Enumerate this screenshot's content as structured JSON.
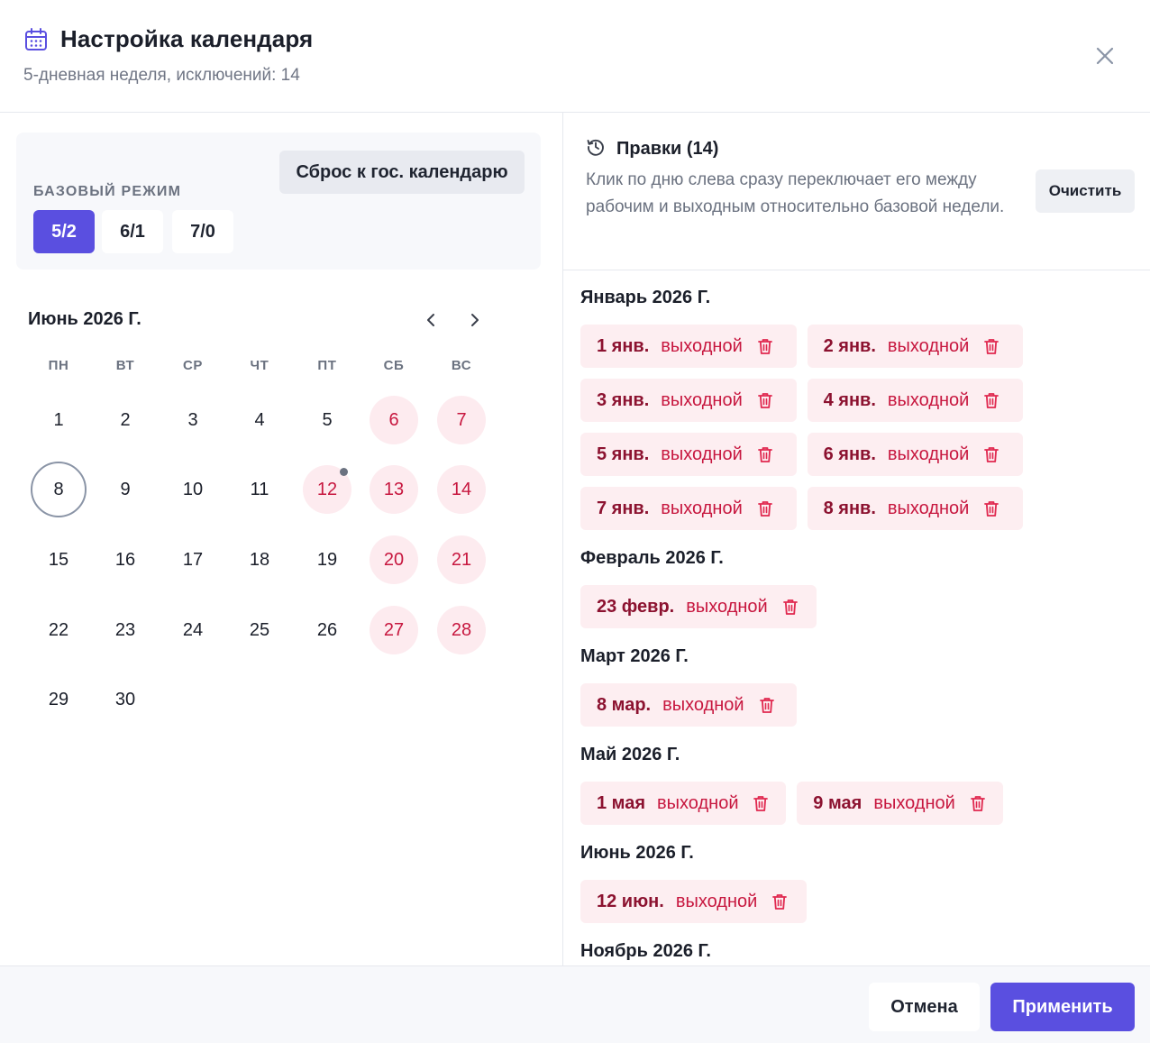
{
  "header": {
    "title": "Настройка календаря",
    "subtitle": "5-дневная неделя, исключений: 14",
    "icon": "calendar-icon",
    "accent": "#5a4fe0"
  },
  "base_mode": {
    "label": "БАЗОВЫЙ РЕЖИМ",
    "reset_label": "Сброс к гос. календарю",
    "modes": [
      "5/2",
      "6/1",
      "7/0"
    ],
    "selected": "5/2"
  },
  "calendar": {
    "month_title": "Июнь 2026 Г.",
    "weekdays": [
      "ПН",
      "ВТ",
      "СР",
      "ЧТ",
      "ПТ",
      "СБ",
      "ВС"
    ],
    "today": 8,
    "weeks": [
      [
        {
          "d": "1"
        },
        {
          "d": "2"
        },
        {
          "d": "3"
        },
        {
          "d": "4"
        },
        {
          "d": "5"
        },
        {
          "d": "6",
          "off": true
        },
        {
          "d": "7",
          "off": true
        }
      ],
      [
        {
          "d": "8",
          "today": true
        },
        {
          "d": "9"
        },
        {
          "d": "10"
        },
        {
          "d": "11"
        },
        {
          "d": "12",
          "off": true,
          "edited": true
        },
        {
          "d": "13",
          "off": true
        },
        {
          "d": "14",
          "off": true
        }
      ],
      [
        {
          "d": "15"
        },
        {
          "d": "16"
        },
        {
          "d": "17"
        },
        {
          "d": "18"
        },
        {
          "d": "19"
        },
        {
          "d": "20",
          "off": true
        },
        {
          "d": "21",
          "off": true
        }
      ],
      [
        {
          "d": "22"
        },
        {
          "d": "23"
        },
        {
          "d": "24"
        },
        {
          "d": "25"
        },
        {
          "d": "26"
        },
        {
          "d": "27",
          "off": true
        },
        {
          "d": "28",
          "off": true
        }
      ],
      [
        {
          "d": "29"
        },
        {
          "d": "30"
        }
      ]
    ],
    "weekend_color": "#c7173f"
  },
  "edits": {
    "title": "Правки (14)",
    "description": "Клик по дню слева сразу переключает его между рабочим и выходным относительно базовой недели.",
    "clear_label": "Очистить",
    "groups": [
      {
        "title": "Январь 2026 Г.",
        "items": [
          {
            "date": "1 янв.",
            "kind": "выходной"
          },
          {
            "date": "2 янв.",
            "kind": "выходной"
          },
          {
            "date": "3 янв.",
            "kind": "выходной"
          },
          {
            "date": "4 янв.",
            "kind": "выходной"
          },
          {
            "date": "5 янв.",
            "kind": "выходной"
          },
          {
            "date": "6 янв.",
            "kind": "выходной"
          },
          {
            "date": "7 янв.",
            "kind": "выходной"
          },
          {
            "date": "8 янв.",
            "kind": "выходной"
          }
        ]
      },
      {
        "title": "Февраль 2026 Г.",
        "items": [
          {
            "date": "23 февр.",
            "kind": "выходной"
          }
        ]
      },
      {
        "title": "Март 2026 Г.",
        "items": [
          {
            "date": "8 мар.",
            "kind": "выходной"
          }
        ]
      },
      {
        "title": "Май 2026 Г.",
        "items": [
          {
            "date": "1 мая",
            "kind": "выходной"
          },
          {
            "date": "9 мая",
            "kind": "выходной"
          }
        ]
      },
      {
        "title": "Июнь 2026 Г.",
        "items": [
          {
            "date": "12 июн.",
            "kind": "выходной"
          }
        ]
      },
      {
        "title": "Ноябрь 2026 Г.",
        "items": []
      }
    ]
  },
  "footer": {
    "cancel_label": "Отмена",
    "apply_label": "Применить"
  }
}
